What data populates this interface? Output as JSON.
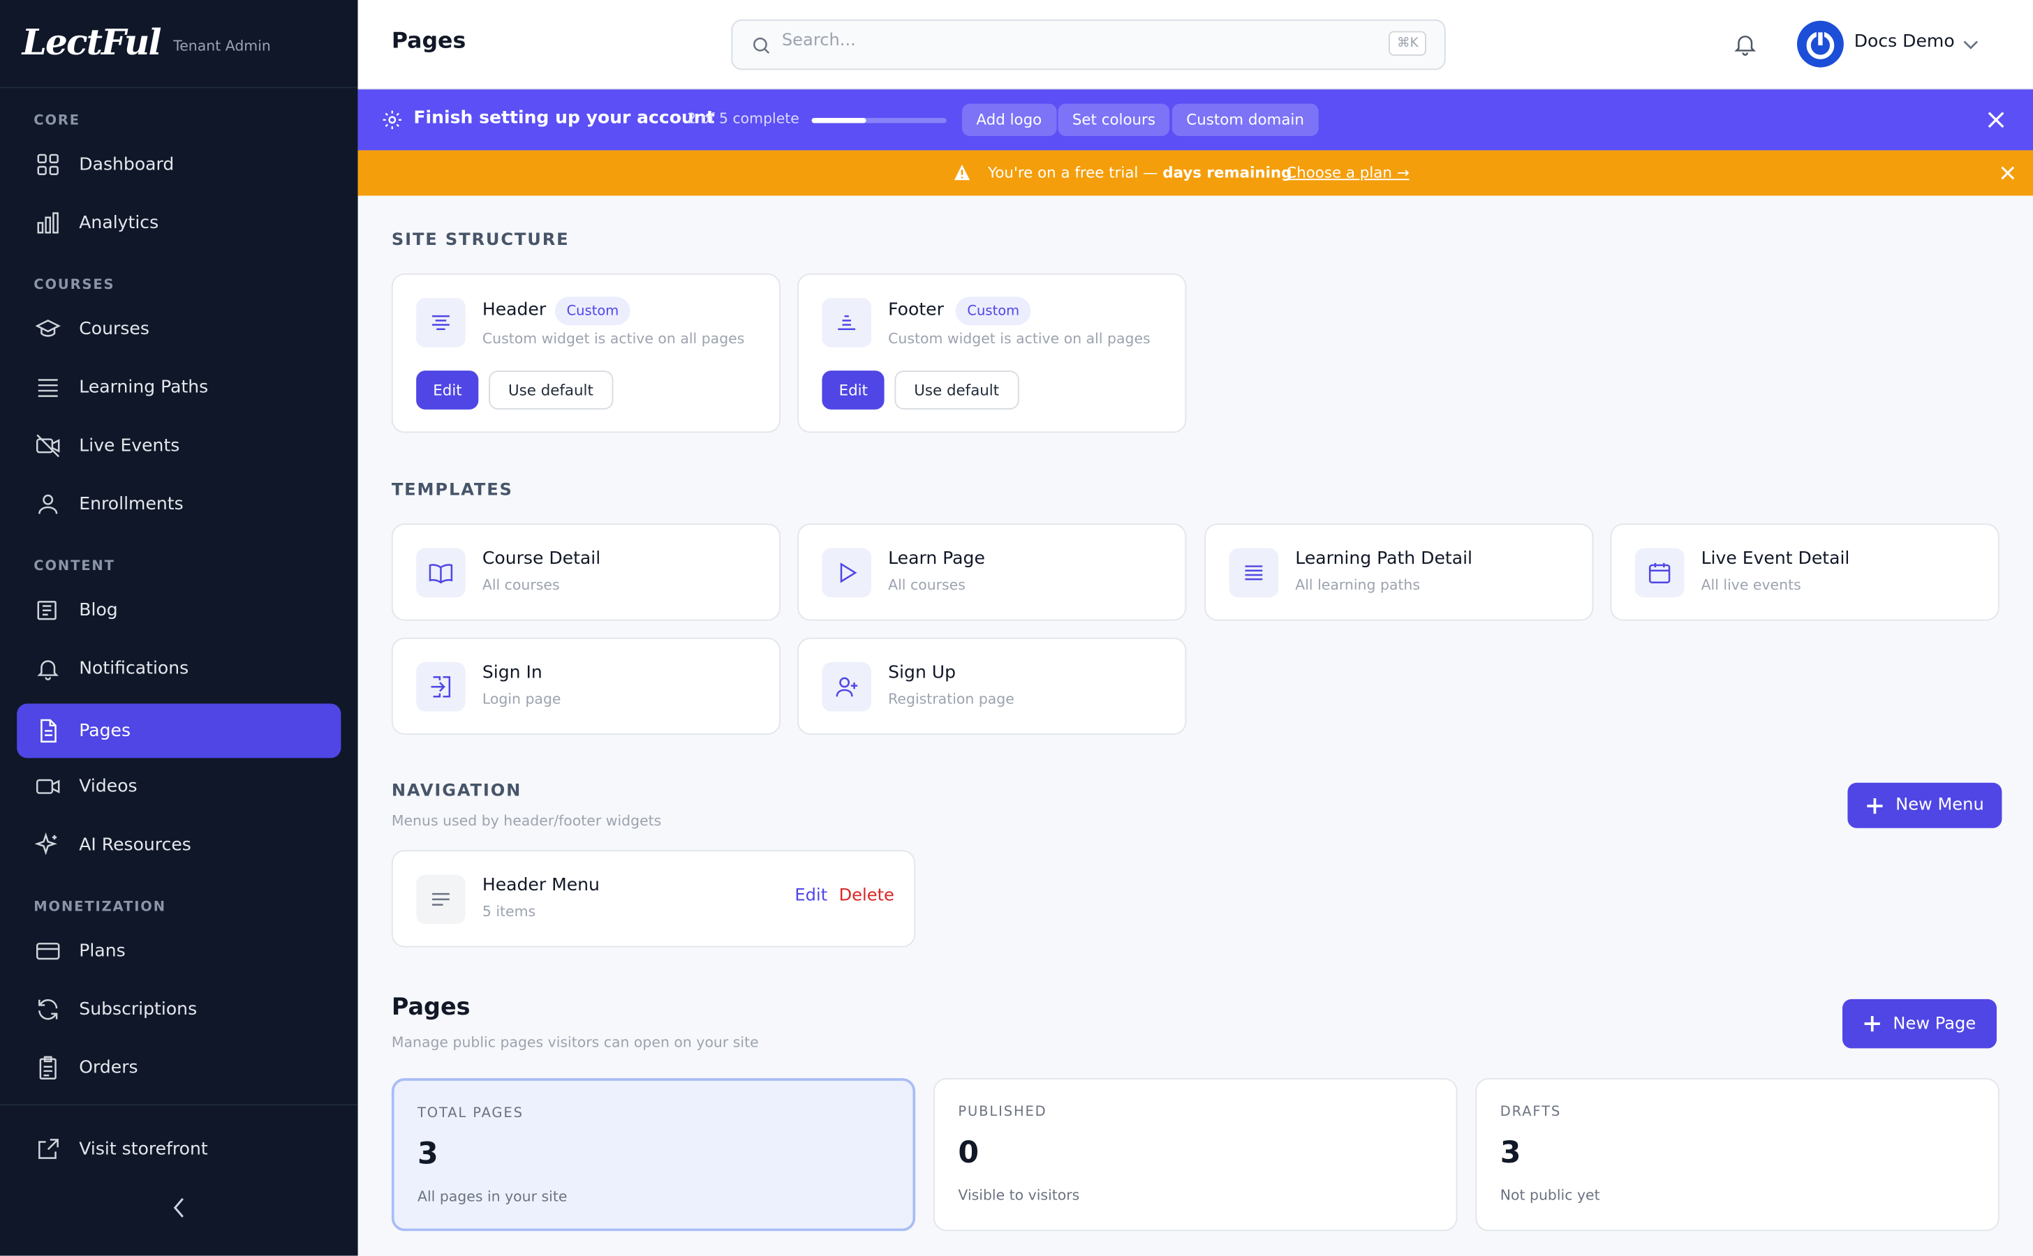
{
  "brand": {
    "logo": "LectFul",
    "subtitle": "Tenant Admin"
  },
  "sidebar": {
    "sections": [
      "CORE",
      "COURSES",
      "CONTENT",
      "MONETIZATION"
    ],
    "items": [
      {
        "label": "Dashboard",
        "icon": "grid-icon"
      },
      {
        "label": "Analytics",
        "icon": "bar-chart-icon"
      },
      {
        "label": "Courses",
        "icon": "graduation-cap-icon"
      },
      {
        "label": "Learning Paths",
        "icon": "list-stack-icon"
      },
      {
        "label": "Live Events",
        "icon": "video-off-icon"
      },
      {
        "label": "Enrollments",
        "icon": "user-icon"
      },
      {
        "label": "Blog",
        "icon": "newspaper-icon"
      },
      {
        "label": "Notifications",
        "icon": "bell-icon"
      },
      {
        "label": "Pages",
        "icon": "file-text-icon",
        "active": true
      },
      {
        "label": "Videos",
        "icon": "video-icon"
      },
      {
        "label": "AI Resources",
        "icon": "sparkles-icon"
      },
      {
        "label": "Plans",
        "icon": "credit-card-icon"
      },
      {
        "label": "Subscriptions",
        "icon": "refresh-icon"
      },
      {
        "label": "Orders",
        "icon": "clipboard-icon"
      }
    ],
    "footer": {
      "label": "Visit storefront",
      "icon": "external-link-icon"
    }
  },
  "header": {
    "title": "Pages",
    "search_placeholder": "Search...",
    "shortcut": "⌘K",
    "user": "Docs Demo"
  },
  "setup_banner": {
    "title": "Finish setting up your account",
    "progress_text": "· 2 of 5 complete",
    "progress": 0.4,
    "chips": [
      "Add logo",
      "Set colours",
      "Custom domain"
    ]
  },
  "trial_banner": {
    "message_start": "You're on a free trial — ",
    "message_bold": "days remaining",
    "message_end": ".",
    "link": "Choose a plan →"
  },
  "site_structure": {
    "heading": "SITE STRUCTURE",
    "cards": [
      {
        "title": "Header",
        "badge": "Custom",
        "subtitle": "Custom widget is active on all pages",
        "edit": "Edit",
        "default": "Use default"
      },
      {
        "title": "Footer",
        "badge": "Custom",
        "subtitle": "Custom widget is active on all pages",
        "edit": "Edit",
        "default": "Use default"
      }
    ]
  },
  "templates": {
    "heading": "TEMPLATES",
    "cards": [
      {
        "title": "Course Detail",
        "subtitle": "All courses"
      },
      {
        "title": "Learn Page",
        "subtitle": "All courses"
      },
      {
        "title": "Learning Path Detail",
        "subtitle": "All learning paths"
      },
      {
        "title": "Live Event Detail",
        "subtitle": "All live events"
      },
      {
        "title": "Sign In",
        "subtitle": "Login page"
      },
      {
        "title": "Sign Up",
        "subtitle": "Registration page"
      }
    ]
  },
  "navigation": {
    "heading": "NAVIGATION",
    "subtitle": "Menus used by header/footer widgets",
    "new_button": "New Menu",
    "menus": [
      {
        "title": "Header Menu",
        "subtitle": "5 items",
        "edit": "Edit",
        "delete": "Delete"
      }
    ]
  },
  "pages": {
    "heading": "Pages",
    "subtitle": "Manage public pages visitors can open on your site",
    "new_button": "New Page",
    "stats": [
      {
        "label": "TOTAL PAGES",
        "value": "3",
        "desc": "All pages in your site"
      },
      {
        "label": "PUBLISHED",
        "value": "0",
        "desc": "Visible to visitors"
      },
      {
        "label": "DRAFTS",
        "value": "3",
        "desc": "Not public yet"
      }
    ]
  },
  "colors": {
    "accent": "#4f46e5",
    "sidebar_bg": "#0f1729",
    "setup_banner": "#5b4ff5",
    "trial_banner": "#f59e0b",
    "delete": "#dc2626"
  }
}
